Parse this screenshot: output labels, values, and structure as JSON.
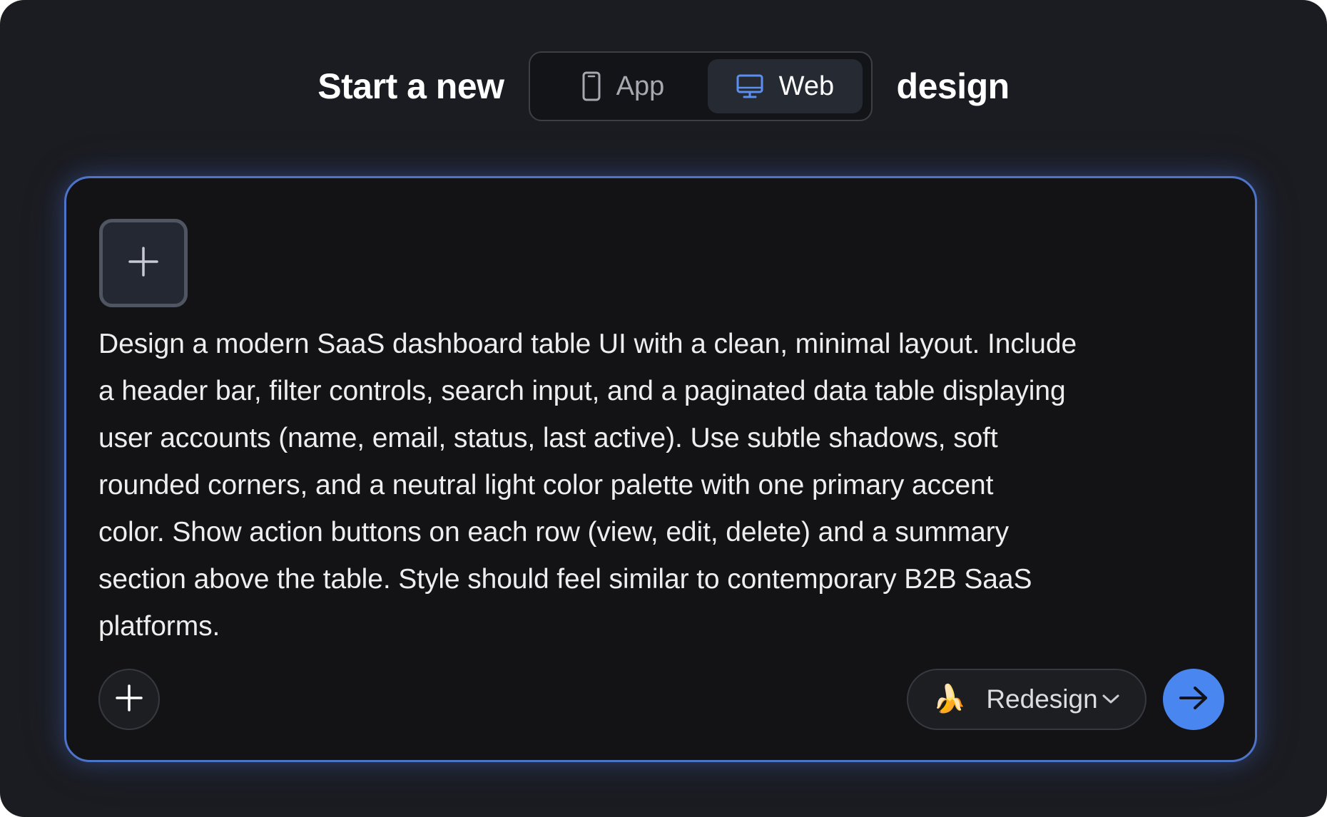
{
  "header": {
    "title_prefix": "Start a new",
    "title_suffix": "design",
    "mode_toggle": {
      "options": [
        {
          "label": "App",
          "icon": "phone-icon",
          "selected": false
        },
        {
          "label": "Web",
          "icon": "monitor-icon",
          "selected": true
        }
      ]
    }
  },
  "prompt": {
    "attach_icon": "plus-icon",
    "text": "Design a modern SaaS dashboard table UI with a clean, minimal layout. Include\na header bar, filter controls, search input, and a paginated data table displaying\nuser accounts (name, email, status, last active). Use subtle shadows, soft\nrounded corners, and a neutral light color palette with one primary accent\ncolor. Show action buttons on each row (view, edit, delete) and a summary\nsection above the table. Style should feel similar to contemporary B2B SaaS\nplatforms."
  },
  "footer": {
    "add_icon": "plus-icon",
    "model": {
      "emoji": "🍌",
      "label": "Redesign",
      "icon": "chevron-down-icon"
    },
    "send_icon": "arrow-right-icon"
  },
  "colors": {
    "background": "#1b1c21",
    "card": "#131316",
    "accent_border": "#4d74c7",
    "send_button": "#4a86f0",
    "selected_toggle": "#262a33"
  }
}
